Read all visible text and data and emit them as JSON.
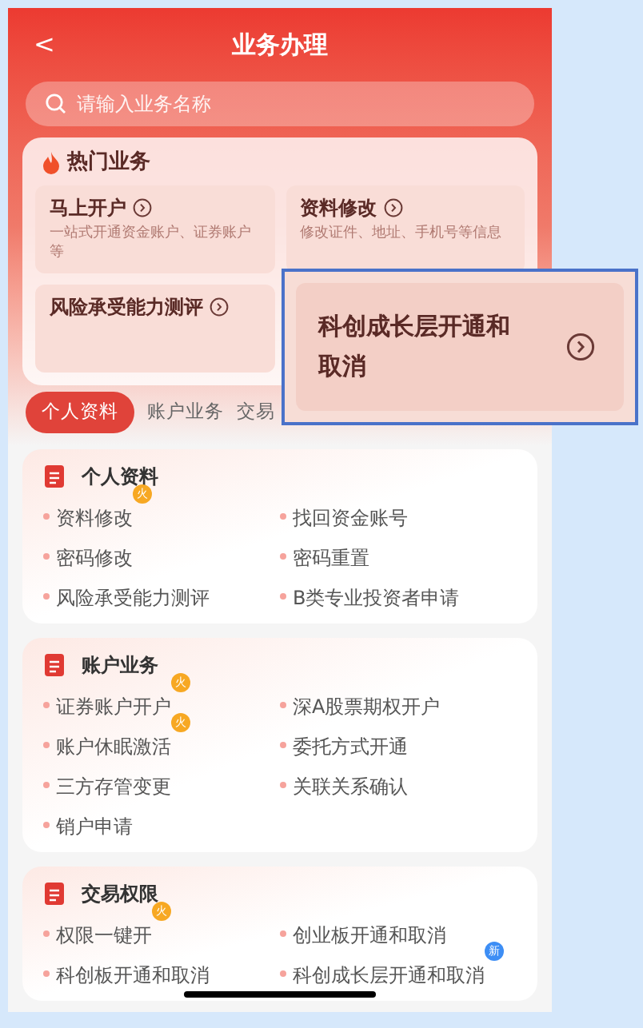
{
  "header": {
    "back": "<",
    "title": "业务办理"
  },
  "search": {
    "placeholder": "请输入业务名称"
  },
  "hot": {
    "title": "热门业务",
    "items": [
      {
        "title": "马上开户",
        "desc": "一站式开通资金账户、证券账户等"
      },
      {
        "title": "资料修改",
        "desc": "修改证件、地址、手机号等信息"
      },
      {
        "title": "风险承受能力测评"
      }
    ]
  },
  "callout": {
    "title": "科创成长层开通和取消"
  },
  "tabs": [
    {
      "label": "个人资料",
      "selected": true
    },
    {
      "label": "账户业务",
      "selected": false
    },
    {
      "label": "交易",
      "selected": false
    }
  ],
  "sections": [
    {
      "title": "个人资料",
      "items": [
        {
          "label": "资料修改",
          "badge": {
            "text": "火",
            "kind": "hot"
          }
        },
        {
          "label": "找回资金账号"
        },
        {
          "label": "密码修改"
        },
        {
          "label": "密码重置"
        },
        {
          "label": "风险承受能力测评"
        },
        {
          "label": "B类专业投资者申请"
        }
      ]
    },
    {
      "title": "账户业务",
      "items": [
        {
          "label": "证券账户开户",
          "badge": {
            "text": "火",
            "kind": "hot"
          }
        },
        {
          "label": "深A股票期权开户"
        },
        {
          "label": "账户休眠激活",
          "badge": {
            "text": "火",
            "kind": "hot"
          }
        },
        {
          "label": "委托方式开通"
        },
        {
          "label": "三方存管变更"
        },
        {
          "label": "关联关系确认"
        },
        {
          "label": "销户申请"
        }
      ]
    },
    {
      "title": "交易权限",
      "items": [
        {
          "label": "权限一键开",
          "badge": {
            "text": "火",
            "kind": "hot"
          }
        },
        {
          "label": "创业板开通和取消"
        },
        {
          "label": "科创板开通和取消"
        },
        {
          "label": "科创成长层开通和取消",
          "badge": {
            "text": "新",
            "kind": "new"
          }
        }
      ]
    }
  ]
}
